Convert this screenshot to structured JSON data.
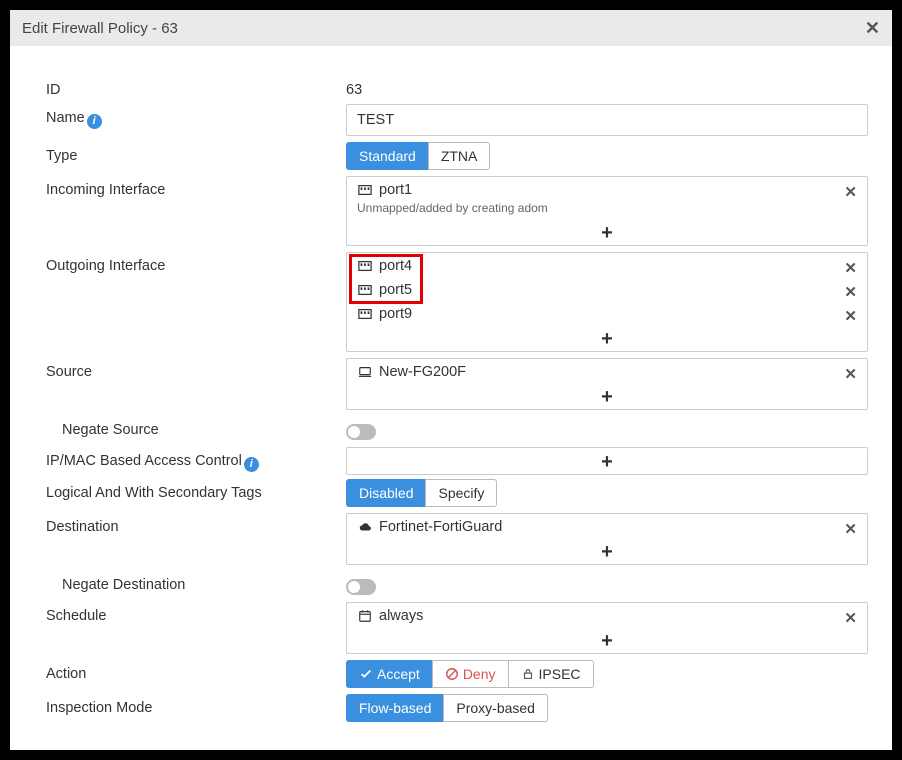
{
  "title": "Edit Firewall Policy - 63",
  "fields": {
    "id_label": "ID",
    "id_value": "63",
    "name_label": "Name",
    "name_value": "TEST",
    "type_label": "Type",
    "type_options": {
      "standard": "Standard",
      "ztna": "ZTNA"
    },
    "incoming_label": "Incoming Interface",
    "incoming_items": [
      {
        "name": "port1",
        "sub": "Unmapped/added by creating adom"
      }
    ],
    "outgoing_label": "Outgoing Interface",
    "outgoing_items": [
      {
        "name": "port4"
      },
      {
        "name": "port5"
      },
      {
        "name": "port9"
      }
    ],
    "source_label": "Source",
    "source_items": [
      {
        "name": "New-FG200F"
      }
    ],
    "negate_source_label": "Negate Source",
    "ipmac_label": "IP/MAC Based Access Control",
    "logical_label": "Logical And With Secondary Tags",
    "logical_options": {
      "disabled": "Disabled",
      "specify": "Specify"
    },
    "destination_label": "Destination",
    "destination_items": [
      {
        "name": "Fortinet-FortiGuard"
      }
    ],
    "negate_destination_label": "Negate Destination",
    "schedule_label": "Schedule",
    "schedule_items": [
      {
        "name": "always"
      }
    ],
    "action_label": "Action",
    "action_options": {
      "accept": "Accept",
      "deny": "Deny",
      "ipsec": "IPSEC"
    },
    "inspection_label": "Inspection Mode",
    "inspection_options": {
      "flow": "Flow-based",
      "proxy": "Proxy-based"
    }
  }
}
